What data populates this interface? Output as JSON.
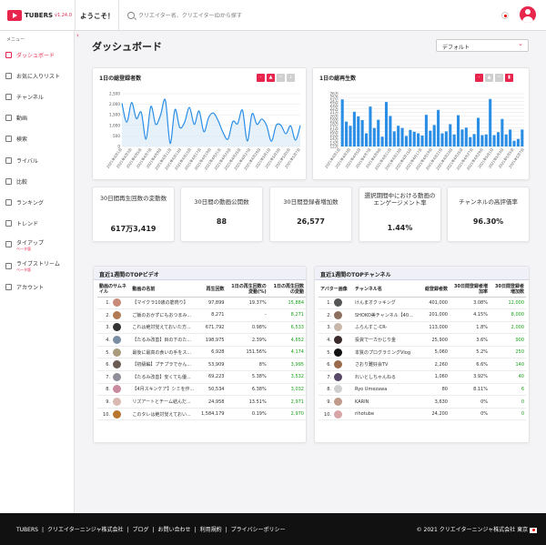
{
  "header": {
    "brand": "TUBERS",
    "version": "v1.24.0",
    "welcome": "ようこそ！",
    "search_placeholder": "クリエイター名、クリエイターIDから探す"
  },
  "sidebar": {
    "menu_label": "メニュー",
    "items": [
      {
        "label": "ダッシュボード",
        "active": true,
        "icon": "home-icon"
      },
      {
        "label": "お気に入りリスト",
        "icon": "heart-icon"
      },
      {
        "label": "チャンネル",
        "icon": "play-icon"
      },
      {
        "label": "動画",
        "icon": "video-icon"
      },
      {
        "label": "検索",
        "icon": "search-icon"
      },
      {
        "label": "ライバル",
        "icon": "users-icon"
      },
      {
        "label": "比較",
        "icon": "compare-icon"
      },
      {
        "label": "ランキング",
        "icon": "ranking-icon"
      },
      {
        "label": "トレンド",
        "icon": "trend-icon"
      },
      {
        "label": "タイアップ",
        "sub": "ベータ版",
        "icon": "tieup-icon"
      },
      {
        "label": "ライブストリーム",
        "sub": "ベータ版",
        "icon": "live-icon"
      },
      {
        "label": "アカウント",
        "icon": "account-icon"
      }
    ]
  },
  "page": {
    "title": "ダッシュボード",
    "select_value": "デフォルト"
  },
  "colors": {
    "accent": "#e8264d",
    "line": "#2a8ee6",
    "bar": "#2a8ee6",
    "positive": "#1aa11a"
  },
  "chart_data": [
    {
      "type": "area",
      "title": "1日の総登録者数",
      "ylim": [
        0,
        2500
      ],
      "yticks": [
        "2,500",
        "2,000",
        "1,500",
        "1,000",
        "500",
        "0"
      ],
      "x": [
        "2021年4月1日",
        "2021年4月3日",
        "2021年4月5日",
        "2021年4月7日",
        "2021年4月9日",
        "2021年4月11日",
        "2021年4月13日",
        "2021年4月15日",
        "2021年4月17日",
        "2021年4月19日",
        "2021年4月21日",
        "2021年4月23日",
        "2021年4月25日",
        "2021年4月27日",
        "2021年4月29日",
        "2021年5月1日",
        "2021年5月3日",
        "2021年5月5日",
        "2021年5月7日"
      ],
      "values": [
        2050,
        1150,
        2080,
        1320,
        1620,
        350,
        1900,
        1050,
        1480,
        2200,
        150,
        1750,
        900,
        1150,
        1850,
        1050,
        1680,
        700,
        1380,
        1580,
        1200,
        650,
        350,
        1180,
        1080,
        1720,
        260,
        1550,
        1050,
        1300,
        1000,
        250,
        1000,
        1000,
        600,
        980,
        300,
        1000
      ],
      "grid": true
    },
    {
      "type": "bar",
      "title": "1日の総再生数",
      "ylim": [
        12,
        26
      ],
      "yticks": [
        "26万",
        "25万",
        "24万",
        "23万",
        "22万",
        "21万",
        "20万",
        "19万",
        "18万",
        "17万",
        "16万",
        "15万",
        "14万",
        "13万",
        "12万"
      ],
      "x": [
        "2021年4月1日",
        "2021年4月3日",
        "2021年4月5日",
        "2021年4月7日",
        "2021年4月9日",
        "2021年4月11日",
        "2021年4月13日",
        "2021年4月15日",
        "2021年4月17日",
        "2021年4月19日",
        "2021年4月21日",
        "2021年4月23日",
        "2021年4月25日",
        "2021年4月27日",
        "2021年4月29日",
        "2021年5月1日",
        "2021年5月3日",
        "2021年5月5日",
        "2021年5月7日"
      ],
      "values": [
        24.5,
        18.6,
        17.5,
        21.2,
        20.0,
        19.0,
        15.5,
        22.6,
        16.9,
        19.1,
        14.6,
        23.8,
        20.1,
        16.0,
        17.5,
        16.9,
        14.8,
        16.4,
        15.9,
        15.5,
        14.9,
        20.4,
        16.2,
        17.7,
        21.7,
        15.5,
        16.0,
        17.9,
        15.2,
        20.3,
        16.5,
        17.0,
        14.5,
        15.3,
        19.6,
        15.0,
        15.2,
        24.6,
        15.0,
        15.8,
        19.3,
        15.2,
        16.5,
        13.5,
        14.0,
        16.5
      ],
      "grid": true
    }
  ],
  "stats": [
    {
      "label": "30日間再生回数の変動数",
      "value": "617万3,419"
    },
    {
      "label": "30日間の動画公開数",
      "value": "88"
    },
    {
      "label": "30日間登録者増加数",
      "value": "26,577"
    },
    {
      "label": "選択期間中における動画のエンゲージメント率",
      "value": "1.44%"
    },
    {
      "label": "チャンネルの高評価率",
      "value": "96.30%"
    }
  ],
  "top_videos": {
    "title": "直近1週間のTOPビデオ",
    "headers": [
      "動画のサムネイル",
      "動画の名前",
      "再生回数",
      "1日の再生回数の変動(%)",
      "1日の再生回数の変動"
    ],
    "rows": [
      {
        "rank": "1.",
        "name": "【マイクラ10歳の筋肉り】",
        "views": "97,899",
        "pct": "19.37%",
        "diff": "15,884",
        "color": "#c98a7a"
      },
      {
        "rank": "2.",
        "name": "ご飯のおかずにもおつまみ...",
        "views": "8,271",
        "pct": "-",
        "diff": "8,271",
        "color": "#b07a54"
      },
      {
        "rank": "3.",
        "name": "これは絶対覚えておいた方...",
        "views": "671,792",
        "pct": "0.98%",
        "diff": "6,533",
        "color": "#333333"
      },
      {
        "rank": "4.",
        "name": "【たるみ改善】目の下のた...",
        "views": "198,975",
        "pct": "2.39%",
        "diff": "4,652",
        "color": "#7a8ea6"
      },
      {
        "rank": "5.",
        "name": "最後に最高の食いの手をス...",
        "views": "6,928",
        "pct": "151.56%",
        "diff": "4,174",
        "color": "#a89c7c"
      },
      {
        "rank": "6.",
        "name": "【初級編】プチプラでかん...",
        "views": "53,909",
        "pct": "8%",
        "diff": "3,995",
        "color": "#6b5a52"
      },
      {
        "rank": "7.",
        "name": "【たるみ改善】安くても優...",
        "views": "69,223",
        "pct": "5.38%",
        "diff": "3,532",
        "color": "#8f8f99"
      },
      {
        "rank": "8.",
        "name": "【4月スキンケア】シミを作...",
        "views": "50,534",
        "pct": "6.38%",
        "diff": "3,032",
        "color": "#c98aa0"
      },
      {
        "rank": "9.",
        "name": "リズアートとチーム結んだ...",
        "views": "24,958",
        "pct": "13.51%",
        "diff": "2,971",
        "color": "#d9b9b0"
      },
      {
        "rank": "10.",
        "name": "このタレは絶対覚えておい...",
        "views": "1,584,179",
        "pct": "0.19%",
        "diff": "2,970",
        "color": "#b8752e"
      }
    ]
  },
  "top_channels": {
    "title": "直近1週間のTOPチャンネル",
    "headers": [
      "アバター画像",
      "チャンネル名",
      "総登録者数",
      "30日間登録者増加率",
      "30日間登録者増加数"
    ],
    "rows": [
      {
        "rank": "1.",
        "name": "けんまオクッキング",
        "subs": "401,000",
        "pct": "3.08%",
        "diff": "12,000",
        "color": "#555555"
      },
      {
        "rank": "2.",
        "name": "SHOKO美チャンネル【40...",
        "subs": "201,000",
        "pct": "4.15%",
        "diff": "8,000",
        "color": "#8c6f5e"
      },
      {
        "rank": "3.",
        "name": "ふらんすこ-CR-",
        "subs": "113,000",
        "pct": "1.8%",
        "diff": "2,000",
        "color": "#c7b7aa"
      },
      {
        "rank": "4.",
        "name": "投資で一カかじり金",
        "subs": "25,900",
        "pct": "3.6%",
        "diff": "900",
        "color": "#3a2a2a"
      },
      {
        "rank": "5.",
        "name": "本質のプログラミングVlog",
        "subs": "5,060",
        "pct": "5.2%",
        "diff": "250",
        "color": "#111111"
      },
      {
        "rank": "6.",
        "name": "さおり難好会TV",
        "subs": "2,260",
        "pct": "6.6%",
        "diff": "140",
        "color": "#9a6b4a"
      },
      {
        "rank": "7.",
        "name": "れいとしちゃんねる",
        "subs": "1,060",
        "pct": "3.92%",
        "diff": "40",
        "color": "#5a4a6a"
      },
      {
        "rank": "8.",
        "name": "Ryo Umezawa",
        "subs": "80",
        "pct": "8.11%",
        "diff": "6",
        "color": "#cfcfcf"
      },
      {
        "rank": "9.",
        "name": "KARIN",
        "subs": "3,630",
        "pct": "0%",
        "diff": "0",
        "color": "#c09a8a"
      },
      {
        "rank": "10.",
        "name": "rihotube",
        "subs": "24,200",
        "pct": "0%",
        "diff": "0",
        "color": "#d7a5a5"
      }
    ]
  },
  "footer": {
    "links": [
      "TUBERS",
      "|",
      "クリエイターニンジャ株式会社",
      "|",
      "ブログ",
      "|",
      "お問い合わせ",
      "|",
      "利用規約",
      "|",
      "プライバシーポリシー"
    ],
    "copyright": "© 2021 クリエイターニンジャ株式会社 東京"
  }
}
